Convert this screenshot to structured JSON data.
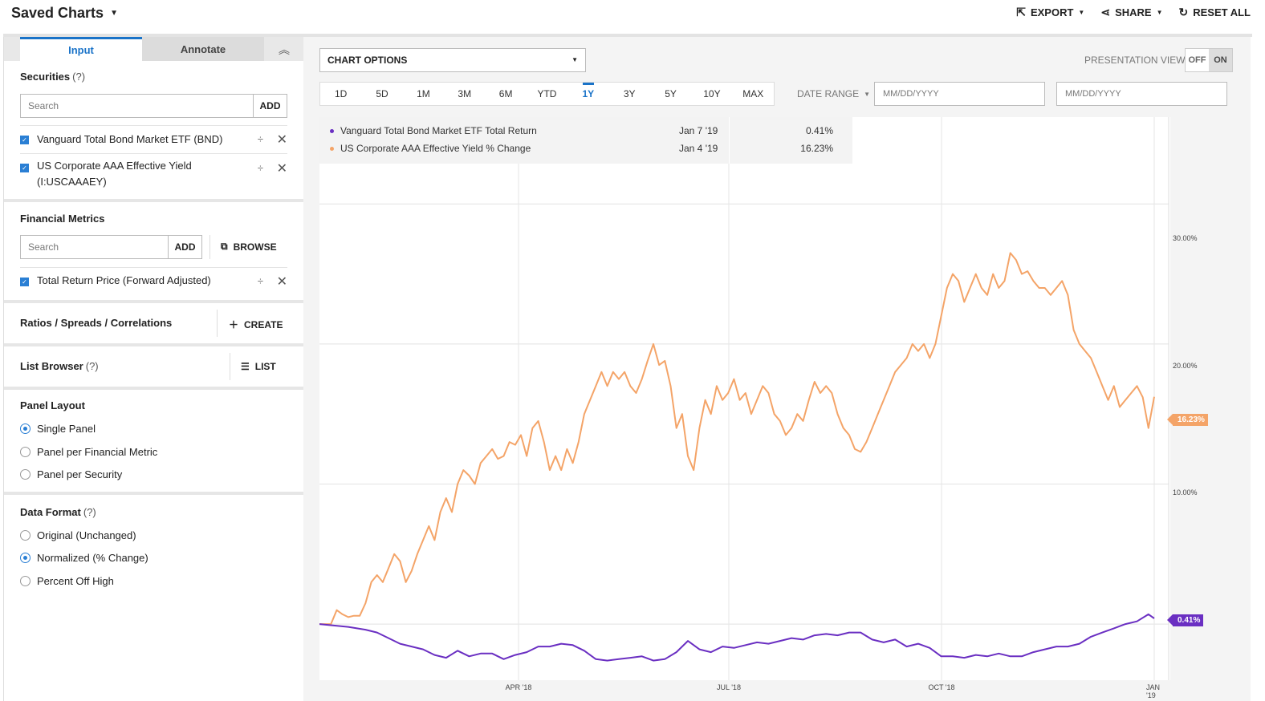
{
  "header": {
    "title": "Saved Charts",
    "actions": [
      {
        "label": "EXPORT",
        "icon": "export-icon"
      },
      {
        "label": "SHARE",
        "icon": "share-icon"
      },
      {
        "label": "RESET ALL",
        "icon": "reset-icon"
      }
    ]
  },
  "sidebar": {
    "tabs": [
      "Input",
      "Annotate"
    ],
    "securities": {
      "title": "Securities",
      "help": "(?)",
      "search_placeholder": "Search",
      "add_label": "ADD",
      "items": [
        {
          "label": "Vanguard Total Bond Market ETF (BND)",
          "checked": true
        },
        {
          "label": "US Corporate AAA Effective Yield",
          "label2": "(I:USCAAAEY)",
          "checked": true
        }
      ]
    },
    "financial_metrics": {
      "title": "Financial Metrics",
      "search_placeholder": "Search",
      "add_label": "ADD",
      "browse_label": "BROWSE",
      "items": [
        {
          "label": "Total Return Price (Forward Adjusted)",
          "checked": true
        }
      ]
    },
    "ratios": {
      "title": "Ratios / Spreads / Correlations",
      "create_label": "CREATE"
    },
    "list_browser": {
      "title": "List Browser",
      "help": "(?)",
      "list_label": "LIST"
    },
    "panel_layout": {
      "title": "Panel Layout",
      "options": [
        "Single Panel",
        "Panel per Financial Metric",
        "Panel per Security"
      ],
      "selected": 0
    },
    "data_format": {
      "title": "Data Format",
      "help": "(?)",
      "options": [
        "Original (Unchanged)",
        "Normalized (% Change)",
        "Percent Off High"
      ],
      "selected": 1
    }
  },
  "toolbar": {
    "chart_options_label": "CHART OPTIONS",
    "presentation_view_label": "PRESENTATION VIEW",
    "toggle_off": "OFF",
    "toggle_on": "ON",
    "ranges": [
      "1D",
      "5D",
      "1M",
      "3M",
      "6M",
      "YTD",
      "1Y",
      "3Y",
      "5Y",
      "10Y",
      "MAX"
    ],
    "selected_range": "1Y",
    "date_range_label": "DATE RANGE",
    "date_from_placeholder": "MM/DD/YYYY",
    "date_to_placeholder": "MM/DD/YYYY"
  },
  "legend": [
    {
      "name": "Vanguard Total Bond Market ETF Total Return",
      "date": "Jan 7 '19",
      "value": "0.41%",
      "color": "#6a2fc2"
    },
    {
      "name": "US Corporate AAA Effective Yield % Change",
      "date": "Jan 4 '19",
      "value": "16.23%",
      "color": "#f4a468"
    }
  ],
  "chart_data": {
    "type": "line",
    "x_labels": [
      "APR '18",
      "JUL '18",
      "OCT '18",
      "JAN '19"
    ],
    "y_ticks": [
      "10.00%",
      "20.00%",
      "30.00%"
    ],
    "ylim": [
      -4,
      36.2
    ],
    "series": [
      {
        "name": "US Corporate AAA Effective Yield % Change",
        "color": "#f4a468",
        "end_label": "16.23%",
        "points": [
          [
            0,
            0
          ],
          [
            2,
            0
          ],
          [
            3,
            1
          ],
          [
            4,
            0.7
          ],
          [
            5,
            0.5
          ],
          [
            6,
            0.6
          ],
          [
            7,
            0.6
          ],
          [
            8,
            1.5
          ],
          [
            9,
            3
          ],
          [
            10,
            3.5
          ],
          [
            11,
            3
          ],
          [
            12,
            4
          ],
          [
            13,
            5
          ],
          [
            14,
            4.5
          ],
          [
            15,
            3
          ],
          [
            16,
            3.8
          ],
          [
            17,
            5
          ],
          [
            18,
            6
          ],
          [
            19,
            7
          ],
          [
            20,
            6
          ],
          [
            21,
            8
          ],
          [
            22,
            9
          ],
          [
            23,
            8
          ],
          [
            24,
            10
          ],
          [
            25,
            11
          ],
          [
            26,
            10.6
          ],
          [
            27,
            10
          ],
          [
            28,
            11.5
          ],
          [
            29,
            12
          ],
          [
            30,
            12.5
          ],
          [
            31,
            11.8
          ],
          [
            32,
            12
          ],
          [
            33,
            13
          ],
          [
            34,
            12.8
          ],
          [
            35,
            13.5
          ],
          [
            36,
            12
          ],
          [
            37,
            14
          ],
          [
            38,
            14.5
          ],
          [
            39,
            13
          ],
          [
            40,
            11
          ],
          [
            41,
            12
          ],
          [
            42,
            11
          ],
          [
            43,
            12.5
          ],
          [
            44,
            11.5
          ],
          [
            45,
            13
          ],
          [
            46,
            15
          ],
          [
            47,
            16
          ],
          [
            48,
            17
          ],
          [
            49,
            18
          ],
          [
            50,
            17
          ],
          [
            51,
            18
          ],
          [
            52,
            17.5
          ],
          [
            53,
            18
          ],
          [
            54,
            17
          ],
          [
            55,
            16.5
          ],
          [
            56,
            17.5
          ],
          [
            57,
            18.8
          ],
          [
            58,
            20
          ],
          [
            59,
            18.5
          ],
          [
            60,
            18.8
          ],
          [
            61,
            17
          ],
          [
            62,
            14
          ],
          [
            63,
            15
          ],
          [
            64,
            12
          ],
          [
            65,
            11
          ],
          [
            66,
            14
          ],
          [
            67,
            16
          ],
          [
            68,
            15
          ],
          [
            69,
            17
          ],
          [
            70,
            16
          ],
          [
            71,
            16.5
          ],
          [
            72,
            17.5
          ],
          [
            73,
            16
          ],
          [
            74,
            16.5
          ],
          [
            75,
            15
          ],
          [
            76,
            16
          ],
          [
            77,
            17
          ],
          [
            78,
            16.5
          ],
          [
            79,
            15
          ],
          [
            80,
            14.5
          ],
          [
            81,
            13.5
          ],
          [
            82,
            14
          ],
          [
            83,
            15
          ],
          [
            84,
            14.5
          ],
          [
            85,
            16
          ],
          [
            86,
            17.3
          ],
          [
            87,
            16.5
          ],
          [
            88,
            17
          ],
          [
            89,
            16.5
          ],
          [
            90,
            15
          ],
          [
            91,
            14
          ],
          [
            92,
            13.5
          ],
          [
            93,
            12.5
          ],
          [
            94,
            12.3
          ],
          [
            95,
            13
          ],
          [
            96,
            14
          ],
          [
            97,
            15
          ],
          [
            98,
            16
          ],
          [
            99,
            17
          ],
          [
            100,
            18
          ],
          [
            101,
            18.5
          ],
          [
            102,
            19
          ],
          [
            103,
            20
          ],
          [
            104,
            19.5
          ],
          [
            105,
            20
          ],
          [
            106,
            19
          ],
          [
            107,
            20
          ],
          [
            108,
            22
          ],
          [
            109,
            24
          ],
          [
            110,
            25
          ],
          [
            111,
            24.5
          ],
          [
            112,
            23
          ],
          [
            113,
            24
          ],
          [
            114,
            25
          ],
          [
            115,
            24
          ],
          [
            116,
            23.5
          ],
          [
            117,
            25
          ],
          [
            118,
            24
          ],
          [
            119,
            24.5
          ],
          [
            120,
            26.5
          ],
          [
            121,
            26
          ],
          [
            122,
            25
          ],
          [
            123,
            25.2
          ],
          [
            124,
            24.5
          ],
          [
            125,
            24
          ],
          [
            126,
            24
          ],
          [
            127,
            23.5
          ],
          [
            128,
            24
          ],
          [
            129,
            24.5
          ],
          [
            130,
            23.5
          ],
          [
            131,
            21
          ],
          [
            132,
            20
          ],
          [
            133,
            19.5
          ],
          [
            134,
            19
          ],
          [
            135,
            18
          ],
          [
            136,
            17
          ],
          [
            137,
            16
          ],
          [
            138,
            17
          ],
          [
            139,
            15.5
          ],
          [
            140,
            16
          ],
          [
            141,
            16.5
          ],
          [
            142,
            17
          ],
          [
            143,
            16.2
          ],
          [
            144,
            14
          ],
          [
            145,
            16.23
          ]
        ]
      },
      {
        "name": "Vanguard Total Bond Market ETF Total Return",
        "color": "#6a2fc2",
        "end_label": "0.41%",
        "points": [
          [
            0,
            0
          ],
          [
            5,
            -0.2
          ],
          [
            8,
            -0.4
          ],
          [
            10,
            -0.6
          ],
          [
            12,
            -1
          ],
          [
            14,
            -1.4
          ],
          [
            16,
            -1.6
          ],
          [
            18,
            -1.8
          ],
          [
            20,
            -2.2
          ],
          [
            22,
            -2.4
          ],
          [
            24,
            -1.9
          ],
          [
            26,
            -2.3
          ],
          [
            28,
            -2.1
          ],
          [
            30,
            -2.1
          ],
          [
            32,
            -2.5
          ],
          [
            34,
            -2.2
          ],
          [
            36,
            -2.0
          ],
          [
            38,
            -1.6
          ],
          [
            40,
            -1.6
          ],
          [
            42,
            -1.4
          ],
          [
            44,
            -1.5
          ],
          [
            46,
            -1.9
          ],
          [
            48,
            -2.5
          ],
          [
            50,
            -2.6
          ],
          [
            52,
            -2.5
          ],
          [
            54,
            -2.4
          ],
          [
            56,
            -2.3
          ],
          [
            58,
            -2.6
          ],
          [
            60,
            -2.5
          ],
          [
            62,
            -2.0
          ],
          [
            64,
            -1.2
          ],
          [
            66,
            -1.8
          ],
          [
            68,
            -2.0
          ],
          [
            70,
            -1.6
          ],
          [
            72,
            -1.7
          ],
          [
            74,
            -1.5
          ],
          [
            76,
            -1.3
          ],
          [
            78,
            -1.4
          ],
          [
            80,
            -1.2
          ],
          [
            82,
            -1.0
          ],
          [
            84,
            -1.1
          ],
          [
            86,
            -0.8
          ],
          [
            88,
            -0.7
          ],
          [
            90,
            -0.8
          ],
          [
            92,
            -0.6
          ],
          [
            94,
            -0.6
          ],
          [
            96,
            -1.1
          ],
          [
            98,
            -1.3
          ],
          [
            100,
            -1.1
          ],
          [
            102,
            -1.6
          ],
          [
            104,
            -1.4
          ],
          [
            106,
            -1.7
          ],
          [
            108,
            -2.3
          ],
          [
            110,
            -2.3
          ],
          [
            112,
            -2.4
          ],
          [
            114,
            -2.2
          ],
          [
            116,
            -2.3
          ],
          [
            118,
            -2.1
          ],
          [
            120,
            -2.3
          ],
          [
            122,
            -2.3
          ],
          [
            124,
            -2.0
          ],
          [
            126,
            -1.8
          ],
          [
            128,
            -1.6
          ],
          [
            130,
            -1.6
          ],
          [
            132,
            -1.4
          ],
          [
            134,
            -0.9
          ],
          [
            136,
            -0.6
          ],
          [
            138,
            -0.3
          ],
          [
            140,
            0.0
          ],
          [
            142,
            0.2
          ],
          [
            144,
            0.7
          ],
          [
            145,
            0.41
          ]
        ]
      }
    ]
  }
}
